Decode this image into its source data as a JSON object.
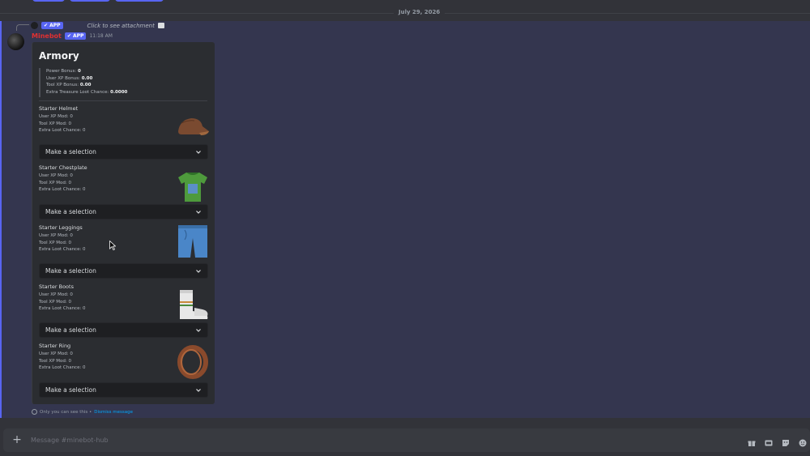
{
  "date_divider": "July 29, 2026",
  "reply": {
    "app_tag": "APP",
    "text": "Click to see attachment",
    "icon": "image-icon"
  },
  "message": {
    "bot_name": "Minebot",
    "app_tag": "APP",
    "timestamp": "11:18 AM"
  },
  "embed": {
    "title": "Armory",
    "stats": {
      "power_bonus_label": "Power Bonus:",
      "power_bonus_value": "0",
      "user_xp_label": "User XP Bonus:",
      "user_xp_value": "0.00",
      "tool_xp_label": "Tool XP Bonus:",
      "tool_xp_value": "0.00",
      "loot_label": "Extra Treasure Loot Chance:",
      "loot_value": "0.0000"
    },
    "items": [
      {
        "name": "Starter Helmet",
        "user_xp": "User XP Mod: 0",
        "tool_xp": "Tool XP Mod: 0",
        "loot": "Extra Loot Chance: 0",
        "icon": "helmet-icon",
        "select": "Make a selection"
      },
      {
        "name": "Starter Chestplate",
        "user_xp": "User XP Mod: 0",
        "tool_xp": "Tool XP Mod: 0",
        "loot": "Extra Loot Chance: 0",
        "icon": "chestplate-icon",
        "select": "Make a selection"
      },
      {
        "name": "Starter Leggings",
        "user_xp": "User XP Mod: 0",
        "tool_xp": "Tool XP Mod: 0",
        "loot": "Extra Loot Chance: 0",
        "icon": "leggings-icon",
        "select": "Make a selection"
      },
      {
        "name": "Starter Boots",
        "user_xp": "User XP Mod: 0",
        "tool_xp": "Tool XP Mod: 0",
        "loot": "Extra Loot Chance: 0",
        "icon": "boots-icon",
        "select": "Make a selection"
      },
      {
        "name": "Starter Ring",
        "user_xp": "User XP Mod: 0",
        "tool_xp": "Tool XP Mod: 0",
        "loot": "Extra Loot Chance: 0",
        "icon": "ring-icon",
        "select": "Make a selection"
      }
    ]
  },
  "ephemeral": {
    "text": "Only you can see this •",
    "dismiss": "Dismiss message"
  },
  "composer": {
    "placeholder": "Message #minebot-hub",
    "icons": [
      "gift-icon",
      "gif-icon",
      "sticker-icon",
      "emoji-icon"
    ]
  },
  "colors": {
    "accent": "#5865f2",
    "bot_name": "#e03030",
    "link": "#00a8fc"
  }
}
